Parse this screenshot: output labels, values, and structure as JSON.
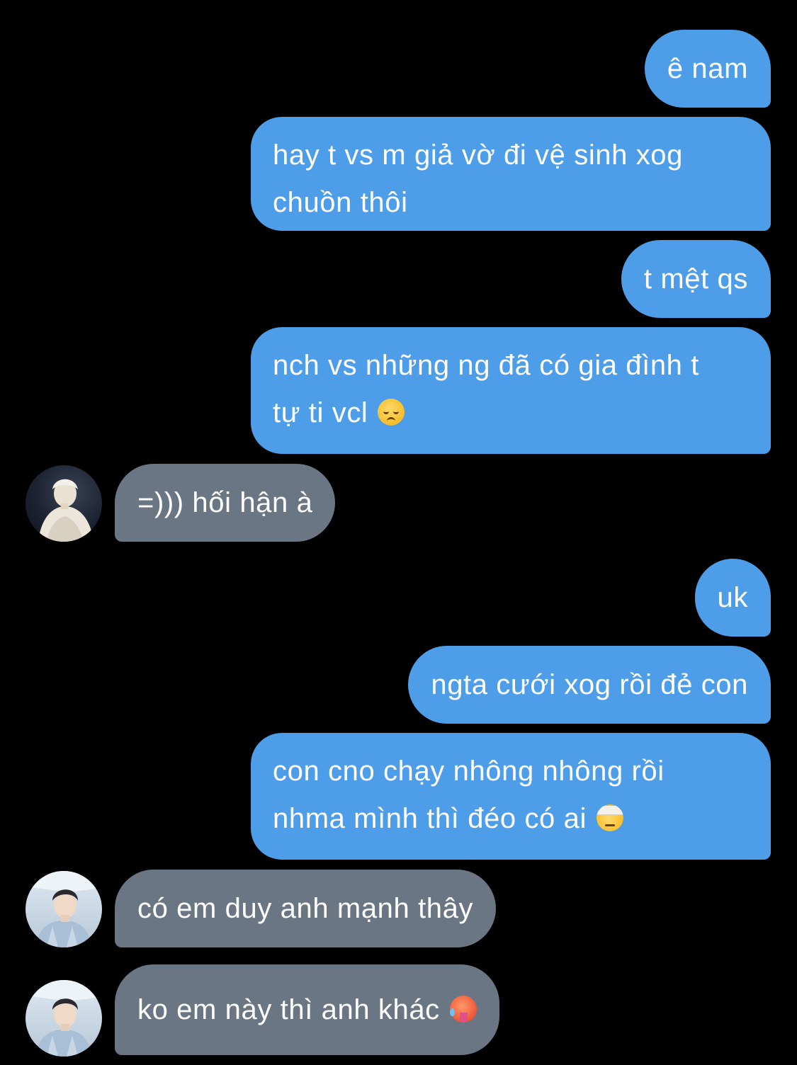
{
  "conversation": {
    "messages": [
      {
        "direction": "outgoing",
        "lines": [
          "ê nam"
        ]
      },
      {
        "direction": "outgoing",
        "lines": [
          "hay t vs m giả vờ đi vệ sinh xog",
          "chuồn thôi"
        ]
      },
      {
        "direction": "outgoing",
        "lines": [
          "t mệt qs"
        ]
      },
      {
        "direction": "outgoing",
        "lines": [
          "nch vs những ng đã có gia đình t",
          "tự ti vcl"
        ],
        "emoji": "disappointed-face-emoji"
      },
      {
        "direction": "incoming",
        "lines": [
          "=))) hối hận à"
        ],
        "avatar": "avatar-contact-1"
      },
      {
        "direction": "outgoing",
        "lines": [
          "uk"
        ]
      },
      {
        "direction": "outgoing",
        "lines": [
          "ngta cưới xog rồi đẻ con"
        ]
      },
      {
        "direction": "outgoing",
        "lines": [
          "con cno chạy nhông nhông rồi",
          "nhma mình thì đéo có ai"
        ],
        "emoji": "face-with-head-bandage-emoji"
      },
      {
        "direction": "incoming",
        "lines": [
          "có em duy anh mạnh thây"
        ],
        "avatar": "avatar-contact-2"
      },
      {
        "direction": "incoming",
        "lines": [
          "ko em này thì anh khác"
        ],
        "avatar": "avatar-contact-2",
        "emoji": "hot-face-emoji"
      }
    ]
  },
  "colors": {
    "background": "#000000",
    "outgoing_bubble": "#4d9de8",
    "incoming_bubble": "#6b7684",
    "bubble_text": "#ffffff"
  }
}
